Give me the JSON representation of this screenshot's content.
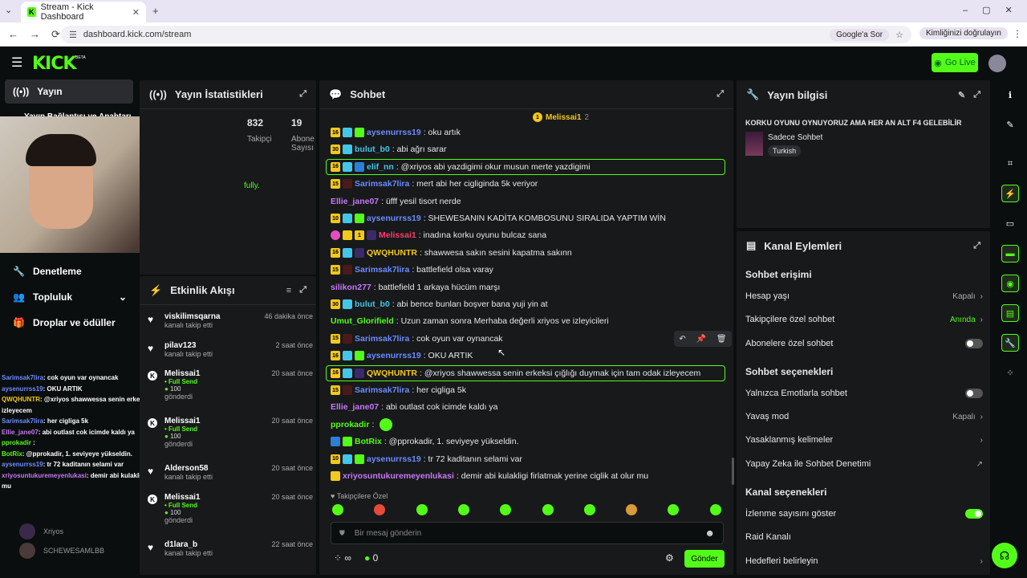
{
  "browser": {
    "tab_title": "Stream - Kick Dashboard",
    "url": "dashboard.kick.com/stream",
    "google_chip": "Google'a Sor",
    "identity_chip": "Kimliğinizi doğrulayın"
  },
  "header": {
    "logo": "KICK",
    "beta": "BETA",
    "go_live": "Go Live"
  },
  "sidebar": {
    "items": [
      {
        "label": "Yayın"
      },
      {
        "label": "Yayın Bağlantısı ve Anahtarı"
      },
      {
        "label": "Denetleme"
      },
      {
        "label": "Topluluk"
      },
      {
        "label": "Droplar ve ödüller"
      }
    ],
    "users": [
      "Xriyos",
      "SCHEWESAMLBB"
    ]
  },
  "stats": {
    "title": "Yayın İstatistikleri",
    "followers_value": "832",
    "followers_label": "Takipçi",
    "subs_value": "19",
    "subs_label": "Abone Sayısı",
    "partial": "fully."
  },
  "activity": {
    "title": "Etkinlik Akışı",
    "events": [
      {
        "name": "viskilimsqarna",
        "sub": "kanalı takip etti",
        "time": "46 dakika önce",
        "type": "follow"
      },
      {
        "name": "pilav123",
        "sub": "kanalı takip etti",
        "time": "2 saat önce",
        "type": "follow"
      },
      {
        "name": "Melissai1",
        "send": "Full Send",
        "amount": "100",
        "sub": "gönderdi",
        "time": "20 saat önce",
        "type": "kick"
      },
      {
        "name": "Melissai1",
        "send": "Full Send",
        "amount": "100",
        "sub": "gönderdi",
        "time": "20 saat önce",
        "type": "kick"
      },
      {
        "name": "Alderson58",
        "sub": "kanalı takip etti",
        "time": "20 saat önce",
        "type": "follow"
      },
      {
        "name": "Melissai1",
        "send": "Full Send",
        "amount": "100",
        "sub": "gönderdi",
        "time": "20 saat önce",
        "type": "kick"
      },
      {
        "name": "d1lara_b",
        "sub": "kanalı takip etti",
        "time": "22 saat önce",
        "type": "follow"
      }
    ]
  },
  "chat": {
    "title": "Sohbet",
    "pinned_user": "Melissai1",
    "pinned_count": "2",
    "messages": [
      {
        "user": "aysenurrss19",
        "text": ": oku artık",
        "color": "#6a8cff",
        "badges": "16,sq,g"
      },
      {
        "user": "bulut_b0",
        "text": ": abi ağrı sarar",
        "color": "#43c6e8",
        "badges": "30,sq"
      },
      {
        "user": "elif_nn",
        "text": ": @xriyos abi yazdigimi okur musun merte yazdigimi",
        "color": "#43c6e8",
        "badges": "16,sq,b",
        "hl": true
      },
      {
        "user": "Sarimsak7lira",
        "text": ": mert abi her cigliginda 5k veriyor",
        "color": "#6a8cff",
        "badges": "15,r"
      },
      {
        "user": "Ellie_jane07",
        "text": ": üfff yesil tisort nerde",
        "color": "#c678f5",
        "badges": ""
      },
      {
        "user": "aysenurrss19",
        "text": ": SHEWESANIN KADİTA KOMBOSUNU SIRALIDA YAPTIM WİN",
        "color": "#6a8cff",
        "badges": "10,sq,g"
      },
      {
        "user": "Melissai1",
        "text": ": inadına korku oyunu bulcaz sana",
        "color": "#ff3b6b",
        "badges": "p,c,1,x"
      },
      {
        "user": "QWQHUNTR",
        "text": ": shawwesa sakın sesini kapatma sakınn",
        "color": "#f3c81d",
        "badges": "16,sq,x"
      },
      {
        "user": "Sarimsak7lira",
        "text": ": battlefield olsa varay",
        "color": "#6a8cff",
        "badges": "15,r"
      },
      {
        "user": "silikon277",
        "text": ": battlefield 1 arkaya hücüm marşı",
        "color": "#c678f5",
        "badges": ""
      },
      {
        "user": "bulut_b0",
        "text": ": abi bence bunları boşver bana yuji yin at",
        "color": "#43c6e8",
        "badges": "30,sq"
      },
      {
        "user": "Umut_Glorifield",
        "text": ": Uzun zaman sonra Merhaba değerli xriyos ve izleyicileri",
        "color": "#53fc18",
        "badges": ""
      },
      {
        "user": "Sarimsak7lira",
        "text": ": cok oyun var oynancak",
        "color": "#6a8cff",
        "badges": "15,r"
      },
      {
        "user": "aysenurrss19",
        "text": ": OKU ARTIK",
        "color": "#6a8cff",
        "badges": "16,sq,g"
      },
      {
        "user": "QWQHUNTR",
        "text": ": @xriyos shawwessa senin erkeksi çığlığı duymak için tam odak izleyecem",
        "color": "#f3c81d",
        "badges": "16,sq,x",
        "hl": true
      },
      {
        "user": "Sarimsak7lira",
        "text": ": her cigliga 5k",
        "color": "#6a8cff",
        "badges": "15,r"
      },
      {
        "user": "Ellie_jane07",
        "text": ": abi outlast cok icimde kaldı ya",
        "color": "#c678f5",
        "badges": ""
      },
      {
        "user": "pprokadir",
        "text": ":",
        "color": "#53fc18",
        "badges": ""
      },
      {
        "user": "BotRix",
        "text": ": @pprokadir, 1. seviyeye yükseldin.",
        "color": "#53fc18",
        "badges": "b,g"
      },
      {
        "user": "aysenurrss19",
        "text": ": tr 72 kaditanın selami var",
        "color": "#6a8cff",
        "badges": "10,sq,g"
      },
      {
        "user": "xriyosuntukuremeyenlukasi",
        "text": ": demir abi kulakligi firlatmak yerine ciglik at olur mu",
        "color": "#c678f5",
        "badges": "c"
      }
    ],
    "followers_only": "Takipçilere Özel",
    "placeholder": "Bir mesaj gönderin",
    "infinity": "∞",
    "points": "0",
    "send": "Gönder"
  },
  "info": {
    "title": "Yayın bilgisi",
    "stream_title": "KORKU OYUNU OYNUYORUZ AMA HER AN ALT F4 GELEBİLİR",
    "category": "Sadece Sohbet",
    "language": "Turkish"
  },
  "actions": {
    "title": "Kanal Eylemleri",
    "sec1": "Sohbet erişimi",
    "account_age": "Hesap yaşı",
    "account_age_val": "Kapalı",
    "followers_chat": "Takipçilere özel sohbet",
    "followers_chat_val": "Anında",
    "subs_chat": "Abonelere özel sohbet",
    "sec2": "Sohbet seçenekleri",
    "emote_only": "Yalnızca Emotlarla sohbet",
    "slow_mode": "Yavaş mod",
    "slow_mode_val": "Kapalı",
    "banned_words": "Yasaklanmış kelimeler",
    "ai_mod": "Yapay Zeka ile Sohbet Denetimi",
    "sec3": "Kanal seçenekleri",
    "show_viewers": "İzlenme sayısını göster",
    "raid": "Raid Kanalı",
    "goals": "Hedefleri belirleyin"
  },
  "overlay": [
    {
      "u": "Sarimsak7lira",
      "t": ": cok oyun var oynancak",
      "c": "#6a8cff"
    },
    {
      "u": "aysenurrss19",
      "t": ": OKU ARTIK",
      "c": "#6a8cff"
    },
    {
      "u": "QWQHUNTR",
      "t": ": @xriyos shawwessa senin erkeksi çığlığı duymak için tam odak",
      "c": "#f3c81d"
    },
    {
      "u": "",
      "t": "izleyecem",
      "c": "#fff"
    },
    {
      "u": "Sarimsak7lira",
      "t": ": her cigliga 5k",
      "c": "#6a8cff"
    },
    {
      "u": "Ellie_jane07",
      "t": ": abi outlast cok icimde kaldı ya",
      "c": "#c678f5"
    },
    {
      "u": "pprokadir",
      "t": " :",
      "c": "#53fc18"
    },
    {
      "u": "BotRix",
      "t": ": @pprokadir, 1. seviyeye yükseldin.",
      "c": "#53fc18"
    },
    {
      "u": "aysenurrss19",
      "t": ": tr 72 kaditanın selami var",
      "c": "#6a8cff"
    },
    {
      "u": "xriyosuntukuremeyenlukasi",
      "t": ": demir abi kulakligi firlatmak yerine ciglik at olur",
      "c": "#c678f5"
    },
    {
      "u": "",
      "t": "mu",
      "c": "#fff"
    }
  ]
}
